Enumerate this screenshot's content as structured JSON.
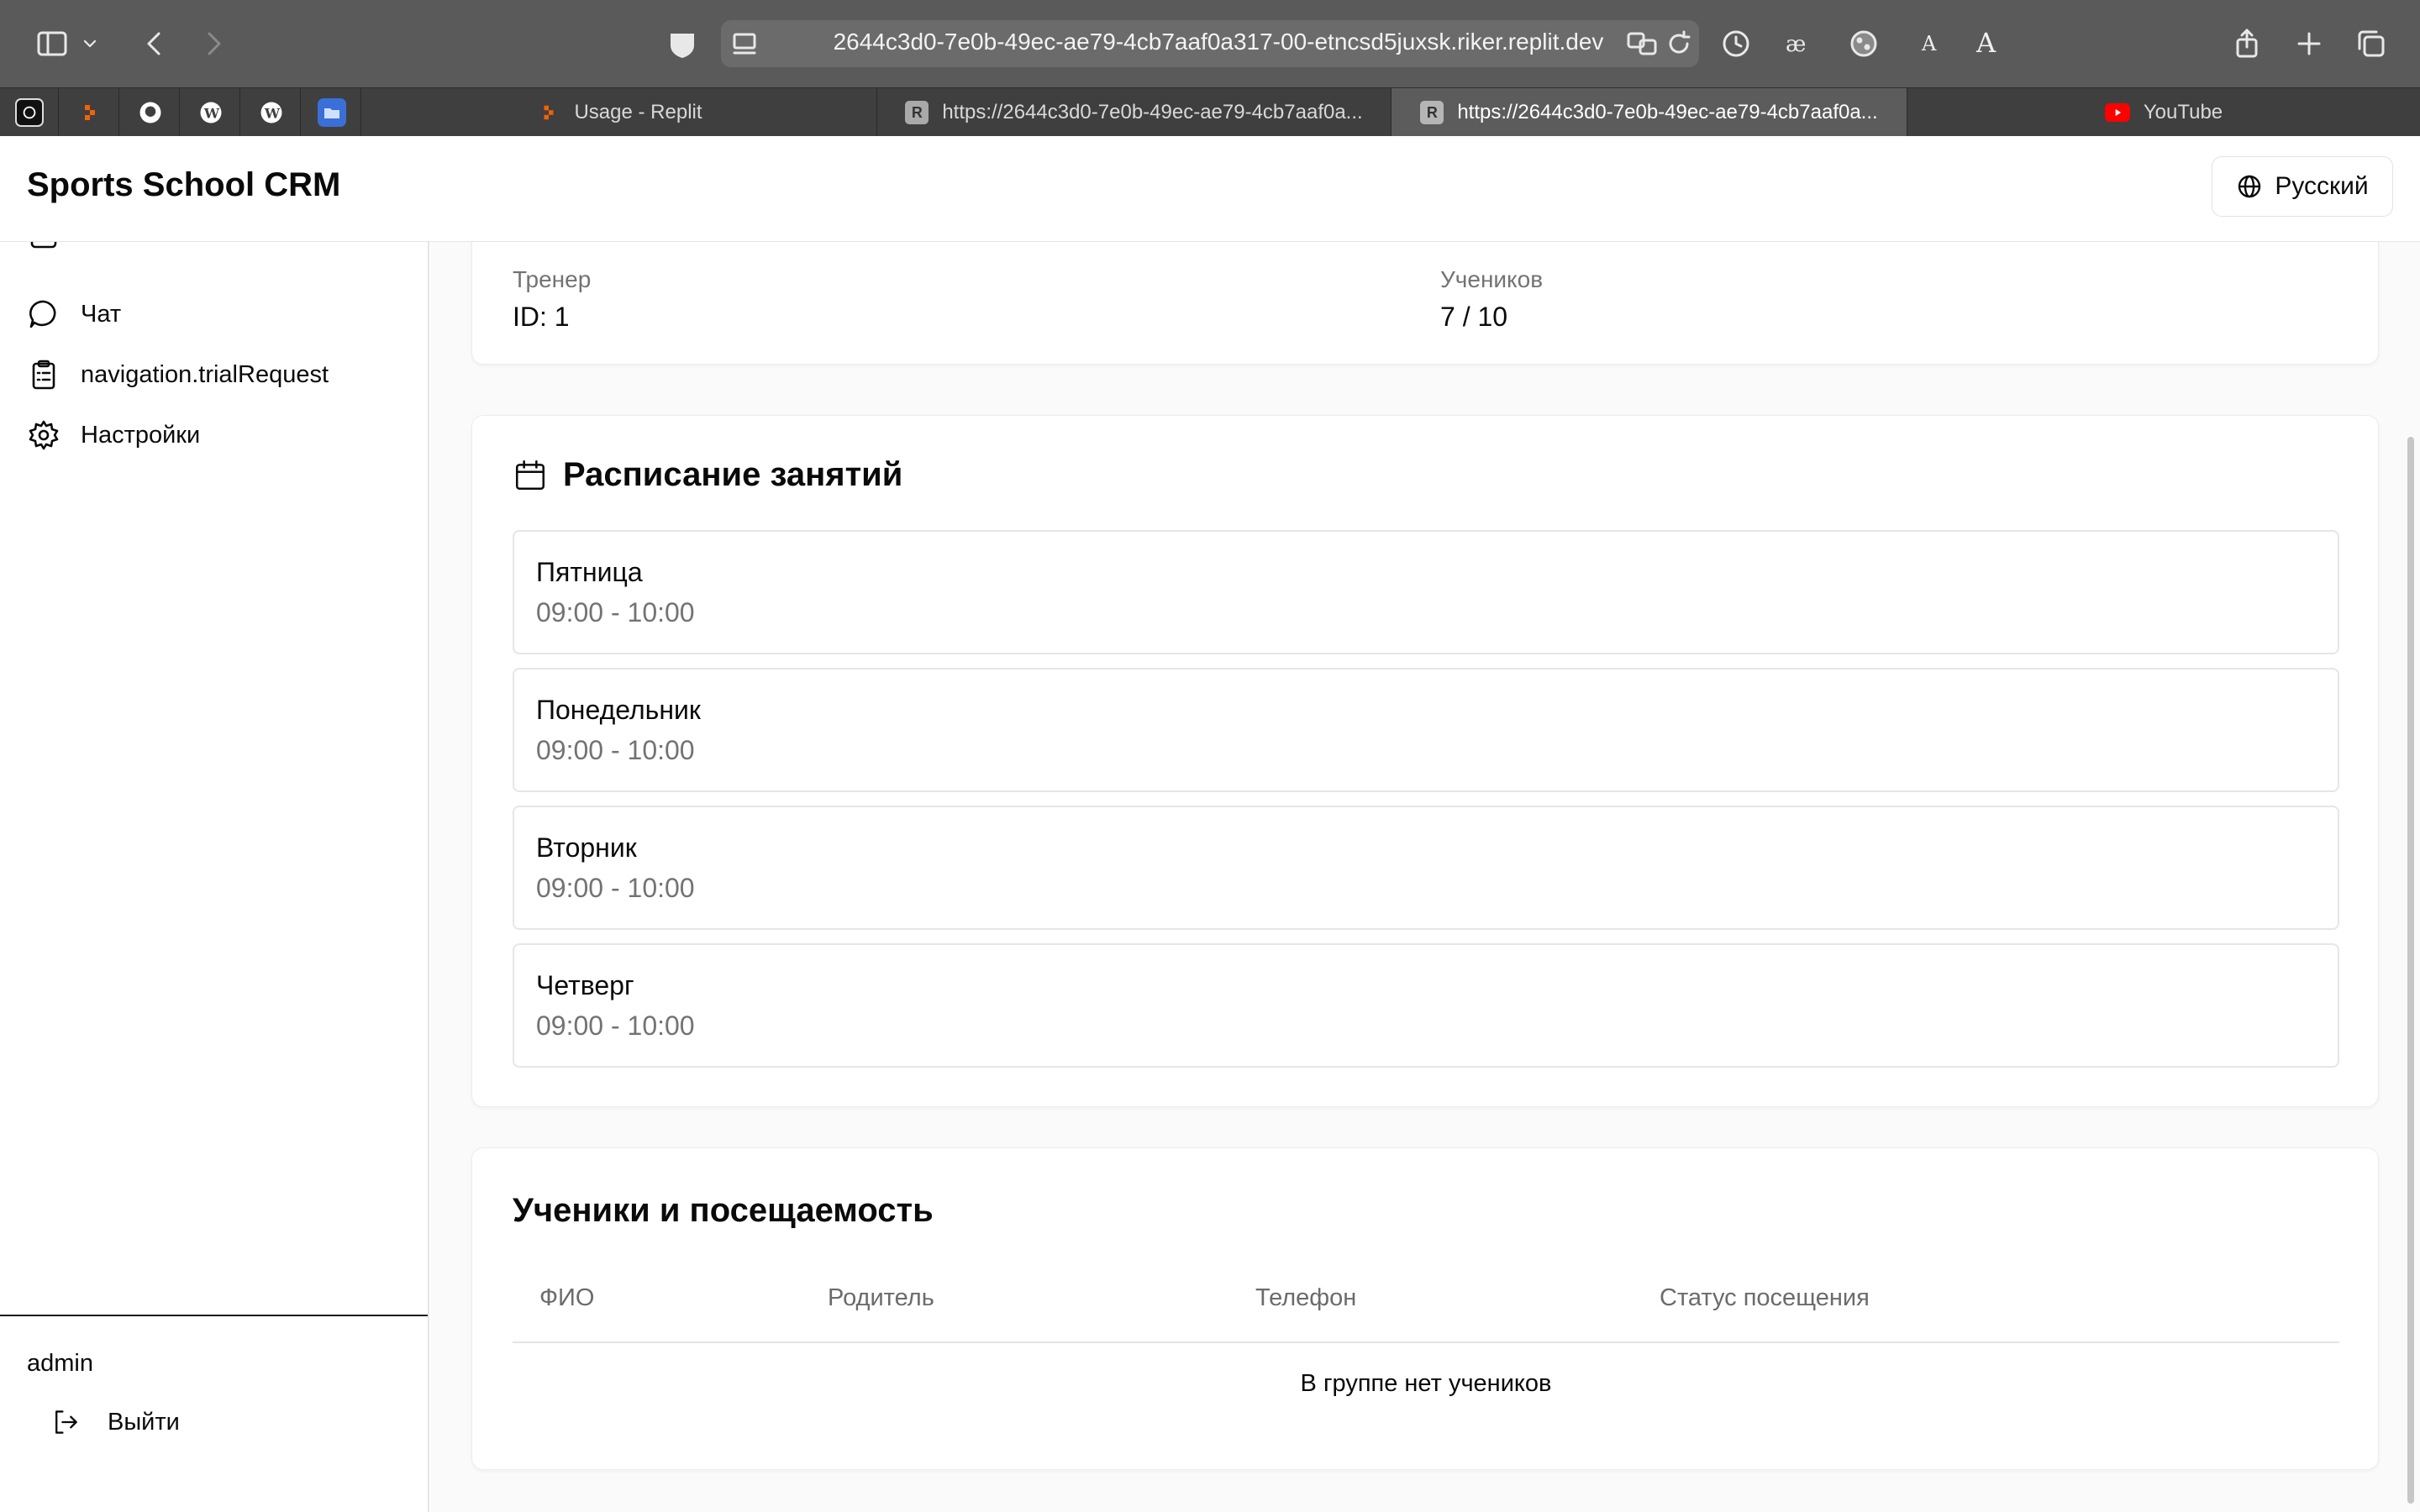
{
  "browser": {
    "url": "2644c3d0-7e0b-49ec-ae79-4cb7aaf0a317-00-etncsd5juxsk.riker.replit.dev",
    "reader_small": "A",
    "reader_large": "A",
    "tabs": [
      {
        "label": "Usage - Replit",
        "favicon": "replit-icon"
      },
      {
        "label": "https://2644c3d0-7e0b-49ec-ae79-4cb7aaf0a...",
        "favicon": "R"
      },
      {
        "label": "https://2644c3d0-7e0b-49ec-ae79-4cb7aaf0a...",
        "favicon": "R",
        "active": true
      },
      {
        "label": "YouTube",
        "favicon": "youtube-icon"
      }
    ]
  },
  "app": {
    "title": "Sports School CRM",
    "language": "Русский"
  },
  "sidebar": {
    "items": [
      {
        "label": "Чат",
        "icon": "chat-icon"
      },
      {
        "label": "navigation.trialRequest",
        "icon": "clipboard-list-icon"
      },
      {
        "label": "Настройки",
        "icon": "gear-icon"
      }
    ],
    "user": "admin",
    "logout": "Выйти"
  },
  "group_info": {
    "coach_label": "Тренер",
    "coach_value": "ID: 1",
    "students_label": "Учеников",
    "students_value": "7 / 10"
  },
  "schedule": {
    "title": "Расписание занятий",
    "slots": [
      {
        "day": "Пятница",
        "time": "09:00 - 10:00"
      },
      {
        "day": "Понедельник",
        "time": "09:00 - 10:00"
      },
      {
        "day": "Вторник",
        "time": "09:00 - 10:00"
      },
      {
        "day": "Четверг",
        "time": "09:00 - 10:00"
      }
    ]
  },
  "students": {
    "title": "Ученики и посещаемость",
    "columns": [
      "ФИО",
      "Родитель",
      "Телефон",
      "Статус посещения"
    ],
    "empty": "В группе нет учеников"
  },
  "colors": {
    "chrome": "#5a5a5a",
    "accent_text": "#0a0a0a",
    "muted_text": "#737373"
  }
}
